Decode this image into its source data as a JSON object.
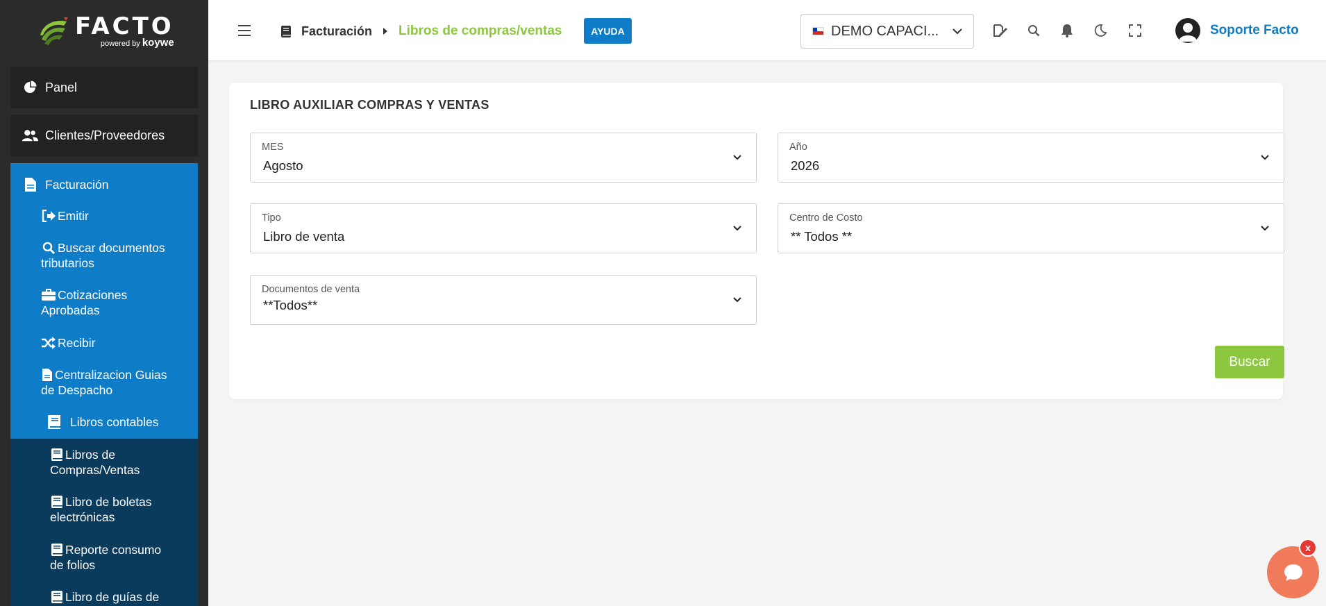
{
  "brand": {
    "name": "FACTO",
    "powered": "powered",
    "by": "by",
    "partner": "koywe"
  },
  "colors": {
    "accent_blue": "#0f7cc7",
    "accent_green": "#8dc63f",
    "sidebar_bg": "#2b2b2b",
    "submenu_bg": "#0a3a5c",
    "chat_orange": "#f07a5a"
  },
  "sidebar": {
    "top_items": [
      {
        "label": "Panel",
        "icon": "pie-chart-icon"
      },
      {
        "label": "Clientes/Proveedores",
        "icon": "users-icon"
      }
    ],
    "facturacion": {
      "label": "Facturación",
      "icon": "file-icon",
      "items": [
        {
          "label": "Emitir",
          "icon": "sign-out-icon"
        },
        {
          "label1": "Buscar documentos",
          "label2": "tributarios",
          "icon": "search-icon"
        },
        {
          "label1": "Cotizaciones",
          "label2": "Aprobadas",
          "icon": "briefcase-icon"
        },
        {
          "label": "Recibir",
          "icon": "shuffle-icon"
        },
        {
          "label1": "Centralizacion Guias",
          "label2": "de Despacho",
          "icon": "file-icon"
        },
        {
          "label": "Libros contables",
          "icon": "book-icon"
        }
      ],
      "sub_items": [
        {
          "label1": "Libros de",
          "label2": "Compras/Ventas",
          "icon": "book-icon"
        },
        {
          "label1": "Libro de boletas",
          "label2": "electrónicas",
          "icon": "book-icon"
        },
        {
          "label1": "Reporte consumo",
          "label2": "de folios",
          "icon": "book-icon"
        },
        {
          "label1": "Libro de guías de",
          "icon": "book-icon"
        }
      ]
    }
  },
  "header": {
    "breadcrumb": {
      "parent": "Facturación",
      "current": "Libros de compras/ventas"
    },
    "help_label": "AYUDA",
    "company": "DEMO CAPACI...",
    "user_name": "Soporte Facto"
  },
  "main": {
    "title": "LIBRO AUXILIAR COMPRAS Y VENTAS",
    "fields": {
      "mes": {
        "label": "MES",
        "value": "Agosto"
      },
      "anio": {
        "label": "Año",
        "value": "2026"
      },
      "tipo": {
        "label": "Tipo",
        "value": "Libro de venta"
      },
      "centro": {
        "label": "Centro de Costo",
        "value": "** Todos **"
      },
      "docs": {
        "label": "Documentos de venta",
        "value": "**Todos**"
      }
    },
    "search_button": "Buscar"
  },
  "chat": {
    "close_label": "x"
  }
}
